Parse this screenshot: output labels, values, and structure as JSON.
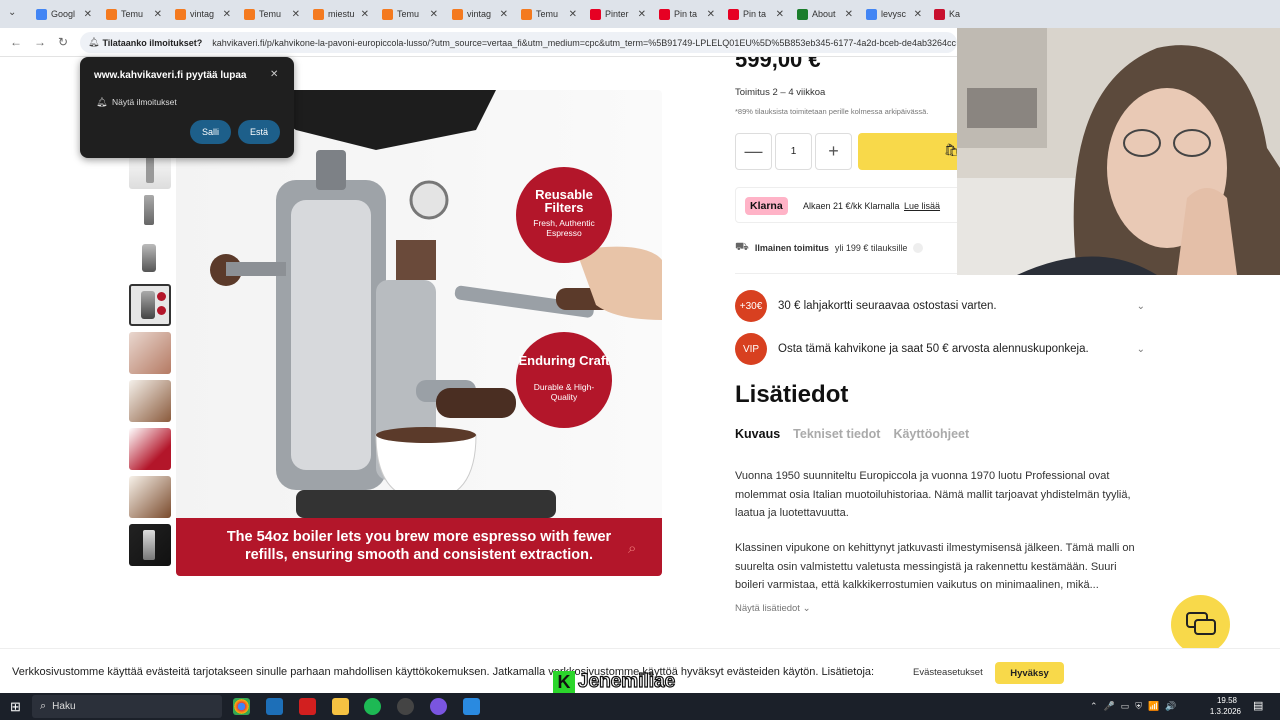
{
  "browser": {
    "tabs": [
      {
        "label": "Googl",
        "color": "#4285f4"
      },
      {
        "label": "Temu",
        "color": "#f47a1f"
      },
      {
        "label": "vintag",
        "color": "#f47a1f"
      },
      {
        "label": "Temu",
        "color": "#f47a1f"
      },
      {
        "label": "miestu",
        "color": "#f47a1f"
      },
      {
        "label": "Temu",
        "color": "#f47a1f"
      },
      {
        "label": "vintag",
        "color": "#f47a1f"
      },
      {
        "label": "Temu",
        "color": "#f47a1f"
      },
      {
        "label": "Pinter",
        "color": "#e60023"
      },
      {
        "label": "Pin ta",
        "color": "#e60023"
      },
      {
        "label": "Pin ta",
        "color": "#e60023"
      },
      {
        "label": "About",
        "color": "#1a7d2b"
      },
      {
        "label": "levysc",
        "color": "#4285f4"
      },
      {
        "label": "Ka",
        "color": "#c8102e"
      }
    ],
    "tab_close": "✕",
    "security_label": "Tilataanko ilmoitukset?",
    "url": "kahvikaveri.fi/p/kahvikone-la-pavoni-europiccola-lusso/?utm_source=vertaa_fi&utm_medium=cpc&utm_term=%5B91749-LPLELQ01EU%5D%5B853eb345-6177-4a2d-bceb-de4ab3264cc"
  },
  "notification_popup": {
    "title": "www.kahvikaveri.fi pyytää lupaa",
    "permission": "Näytä ilmoitukset",
    "allow": "Salli",
    "block": "Estä",
    "close": "✕"
  },
  "product": {
    "price_partial": "599,00 €",
    "delivery": "Toimitus 2 – 4 viikkoa",
    "delivery_note": "*89% tilauksista toimitetaan perille kolmessa arkipäivässä.",
    "quantity": "1",
    "minus": "—",
    "plus": "+",
    "klarna_logo": "Klarna",
    "klarna_text": "Alkaen 21 €/kk Klarnalla",
    "klarna_link": "Lue lisää",
    "shipping_bold": "Ilmainen toimitus",
    "shipping_text": "yli 199 € tilauksille",
    "gift_badge": "+30€",
    "gift_text": "30 € lahjakortti seuraavaa ostostasi varten.",
    "vip_badge": "VIP",
    "vip_text": "Osta tämä kahvikone ja saat 50 € arvosta alennuskuponkeja.",
    "image": {
      "badge1_title": "Reusable Filters",
      "badge1_sub": "Fresh, Authentic Espresso",
      "badge2_title": "Enduring Craft",
      "badge2_sub": "Durable & High-Quality",
      "caption": "The 54oz boiler lets you brew more espresso with fewer refills, ensuring smooth and consistent extraction."
    }
  },
  "details": {
    "heading": "Lisätiedot",
    "tabs": [
      "Kuvaus",
      "Tekniset tiedot",
      "Käyttöohjeet"
    ],
    "para1": "Vuonna 1950 suunniteltu Europiccola ja vuonna 1970 luotu Professional ovat molemmat osia Italian muotoiluhistoriaa. Nämä mallit tarjoavat yhdistelmän tyyliä, laatua ja luotettavuutta.",
    "para2": "Klassinen vipukone on kehittynyt jatkuvasti ilmestymisensä jälkeen. Tämä malli on suurelta osin valmistettu valetusta messingistä ja rakennettu kestämään. Suuri boileri varmistaa, että kalkkikerrostumien vaikutus on minimaalinen, mikä...",
    "show_more": "Näytä lisätiedot"
  },
  "cookie": {
    "text": "Verkkosivustomme käyttää evästeitä tarjotakseen sinulle parhaan mahdollisen käyttökokemuksen. Jatkamalla verkkosivustomme käyttöä hyväksyt evästeiden käytön. Lisätietoja:",
    "settings": "Evästeasetukset",
    "accept": "Hyväksy"
  },
  "overlay_name": "Jenemiliae",
  "taskbar": {
    "search": "Haku",
    "time": "19.58",
    "date": "1.3.2026"
  },
  "colors": {
    "accent_yellow": "#f8d94a",
    "badge_red": "#b3162a",
    "klarna_pink": "#ffb3c7",
    "gift_orange": "#d84020"
  }
}
